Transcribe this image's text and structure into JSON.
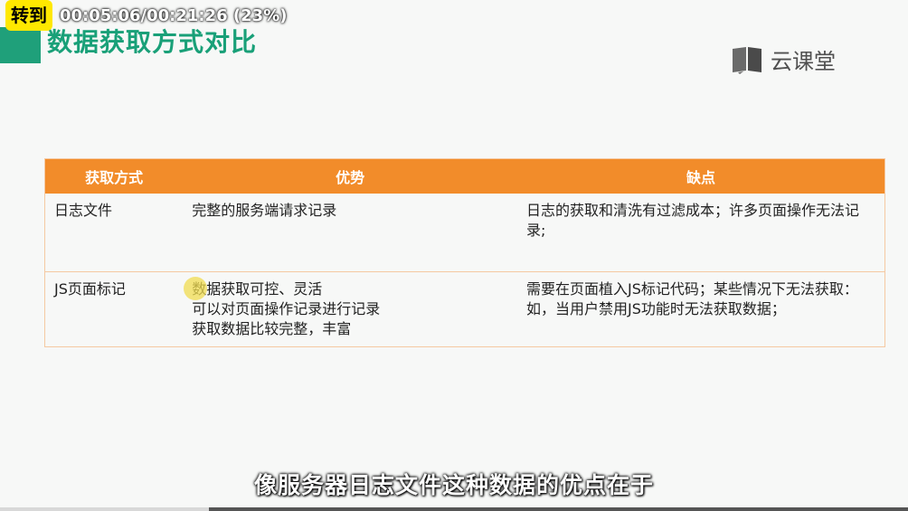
{
  "overlay": {
    "badge": "转到",
    "time": "00:05:06/00:21:26 (23%)",
    "progress": 0.23
  },
  "slide": {
    "title": "数据获取方式对比",
    "logo_text": "云课堂",
    "logo_icon": "book-icon",
    "accent": "#1fa07a",
    "header_color": "#f28c2a"
  },
  "table": {
    "headers": [
      "获取方式",
      "优势",
      "缺点"
    ],
    "rows": [
      {
        "method": "日志文件",
        "pros": [
          "完整的服务端请求记录"
        ],
        "cons": "日志的获取和清洗有过滤成本；许多页面操作无法记录;"
      },
      {
        "method": "JS页面标记",
        "pros": [
          "数据获取可控、灵活",
          "可以对页面操作记录进行记录",
          "获取数据比较完整，丰富"
        ],
        "cons": "需要在页面植入JS标记代码；某些情况下无法获取：如，当用户禁用JS功能时无法获取数据；"
      }
    ]
  },
  "subtitle": "像服务器日志文件这种数据的优点在于"
}
